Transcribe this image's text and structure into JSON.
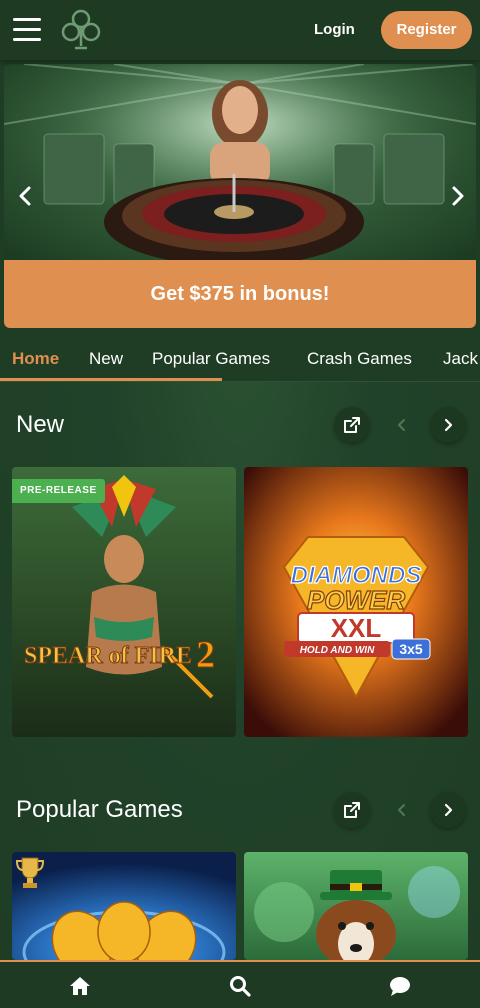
{
  "header": {
    "logo_icon": "club-suit-icon",
    "login_label": "Login",
    "register_label": "Register"
  },
  "banner": {
    "cta_label": "Get $375 in bonus!"
  },
  "tabs": [
    {
      "label": "Home",
      "active": true
    },
    {
      "label": "New",
      "active": false
    },
    {
      "label": "Popular Games",
      "active": false
    },
    {
      "label": "Crash Games",
      "active": false
    },
    {
      "label": "Jack",
      "active": false
    }
  ],
  "sections": {
    "new": {
      "title": "New",
      "games": [
        {
          "name": "SPEAR of FIRE 2",
          "name_line1": "SPEAR of FIRE",
          "name_num": "2",
          "badge": "PRE-RELEASE"
        },
        {
          "name": "DIAMONDS POWER XXL HOLD AND WIN 3x5",
          "line1": "DIAMONDS",
          "line2": "POWER",
          "line3": "XXL",
          "line4": "HOLD AND WIN",
          "line5": "3x5"
        }
      ]
    },
    "popular": {
      "title": "Popular Games"
    }
  },
  "colors": {
    "accent": "#df8f4f",
    "background": "#1f3d25",
    "header": "#1f3a22",
    "badge": "#4caf50"
  }
}
